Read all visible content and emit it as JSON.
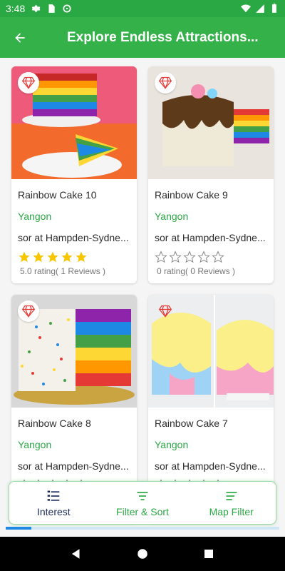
{
  "status_bar": {
    "time": "3:48"
  },
  "app_bar": {
    "title": "Explore Endless Attractions..."
  },
  "cards": [
    {
      "title": "Rainbow Cake 10",
      "city": "Yangon",
      "subtitle": "sor at Hampden-Sydne...",
      "rating": 5,
      "rating_text": "5.0 rating( 1 Reviews )"
    },
    {
      "title": "Rainbow Cake 9",
      "city": "Yangon",
      "subtitle": "sor at Hampden-Sydne...",
      "rating": 0,
      "rating_text": "0 rating( 0 Reviews )"
    },
    {
      "title": "Rainbow Cake 8",
      "city": "Yangon",
      "subtitle": "sor at Hampden-Sydne...",
      "rating": 0,
      "rating_text": ""
    },
    {
      "title": "Rainbow Cake 7",
      "city": "Yangon",
      "subtitle": "sor at Hampden-Sydne...",
      "rating": 0,
      "rating_text": ""
    }
  ],
  "bottom_sheet": {
    "interest_label": "Interest",
    "filter_sort_label": "Filter & Sort",
    "map_filter_label": "Map Filter"
  },
  "colors": {
    "primary": "#35b14a",
    "status": "#2aa844",
    "star": "#f7c600",
    "accent_text": "#2aa844"
  }
}
